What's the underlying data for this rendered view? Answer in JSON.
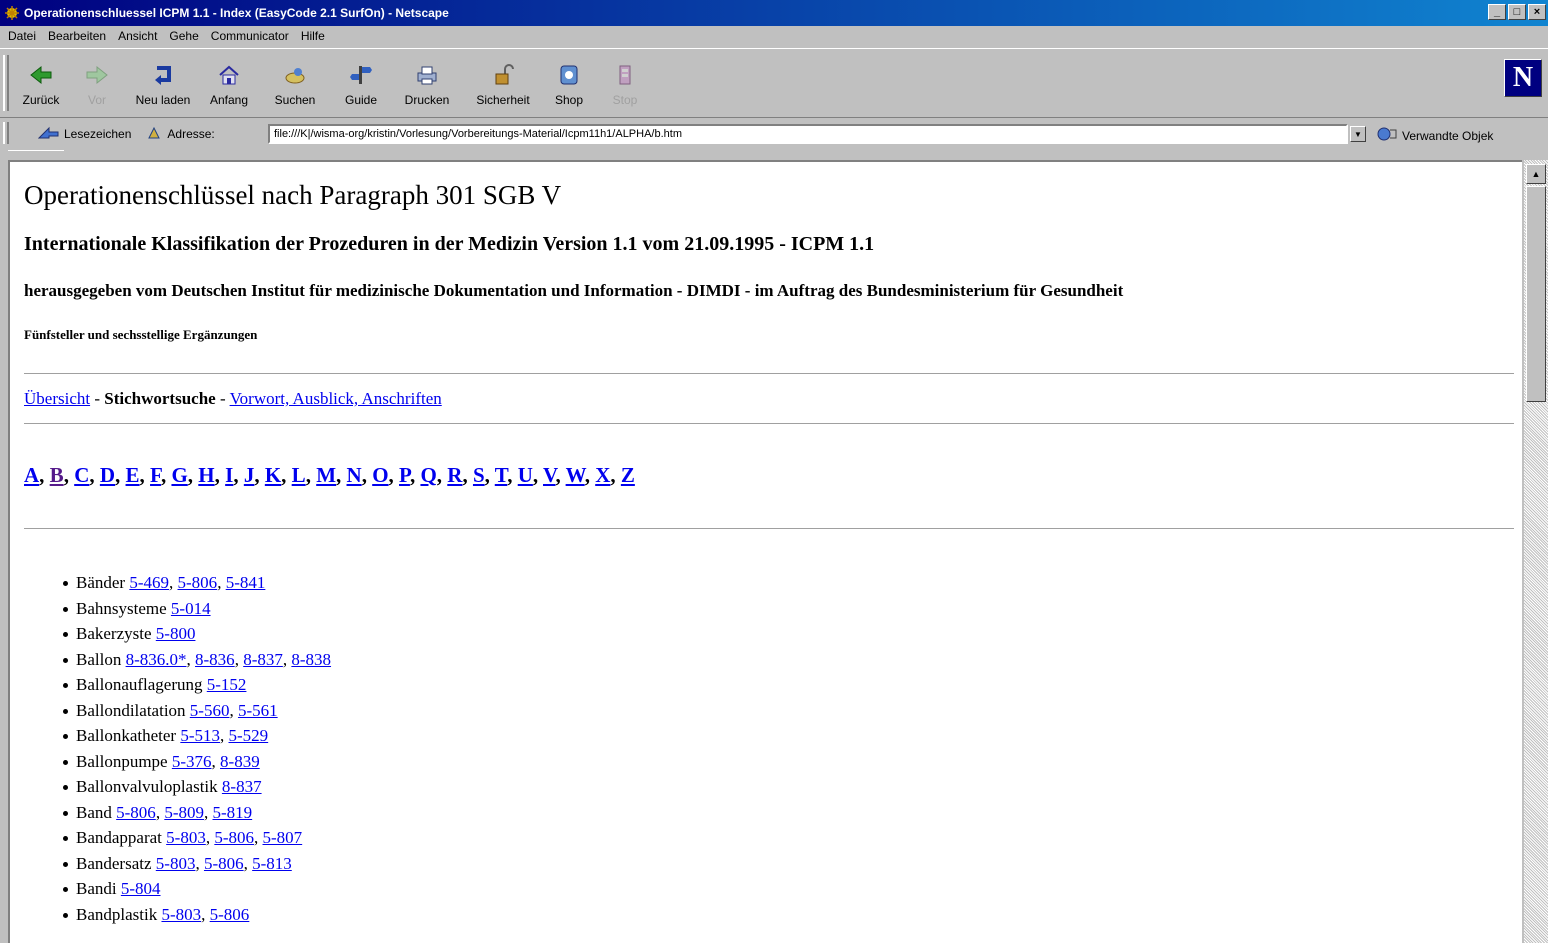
{
  "window": {
    "title": "Operationenschluessel ICPM 1.1 - Index (EasyCode 2.1 SurfOn) - Netscape",
    "controls": {
      "minimize": "_",
      "maximize": "□",
      "close": "×"
    }
  },
  "menu": [
    "Datei",
    "Bearbeiten",
    "Ansicht",
    "Gehe",
    "Communicator",
    "Hilfe"
  ],
  "toolbar": [
    {
      "label": "Zurück",
      "icon": "back-arrow-icon",
      "enabled": true
    },
    {
      "label": "Vor",
      "icon": "forward-arrow-icon",
      "enabled": false
    },
    {
      "label": "Neu laden",
      "icon": "reload-icon",
      "enabled": true
    },
    {
      "label": "Anfang",
      "icon": "home-icon",
      "enabled": true
    },
    {
      "label": "Suchen",
      "icon": "search-icon",
      "enabled": true
    },
    {
      "label": "Guide",
      "icon": "guide-icon",
      "enabled": true
    },
    {
      "label": "Drucken",
      "icon": "print-icon",
      "enabled": true
    },
    {
      "label": "Sicherheit",
      "icon": "lock-icon",
      "enabled": true
    },
    {
      "label": "Shop",
      "icon": "shop-icon",
      "enabled": true
    },
    {
      "label": "Stop",
      "icon": "stop-icon",
      "enabled": false
    }
  ],
  "logo": "N",
  "location": {
    "bookmarks_label": "Lesezeichen",
    "address_label": "Adresse:",
    "url": "file:///K|/wisma-org/kristin/Vorlesung/Vorbereitungs-Material/Icpm11h1/ALPHA/b.htm",
    "related_label": "Verwandte Objek"
  },
  "page": {
    "h1": "Operationenschlüssel nach Paragraph 301 SGB V",
    "h3": "Internationale Klassifikation der Prozeduren in der Medizin Version 1.1 vom 21.09.1995 - ICPM 1.1",
    "h4": "herausgegeben vom Deutschen Institut für medizinische Dokumentation und Information - DIMDI - im Auftrag des Bundesministerium für Gesundheit",
    "h5": "Fünfsteller und sechsstellige Ergänzungen",
    "nav": {
      "overview": "Übersicht",
      "sep1": " - ",
      "current": "Stichwortsuche",
      "sep2": " - ",
      "preface": "Vorwort, Ausblick, Anschriften"
    },
    "letters": [
      "A",
      "B",
      "C",
      "D",
      "E",
      "F",
      "G",
      "H",
      "I",
      "J",
      "K",
      "L",
      "M",
      "N",
      "O",
      "P",
      "Q",
      "R",
      "S",
      "T",
      "U",
      "V",
      "W",
      "X",
      "Z"
    ],
    "current_letter": "B",
    "entries": [
      {
        "term": "Bänder",
        "codes": [
          "5-469",
          "5-806",
          "5-841"
        ]
      },
      {
        "term": "Bahnsysteme",
        "codes": [
          "5-014"
        ]
      },
      {
        "term": "Bakerzyste",
        "codes": [
          "5-800"
        ]
      },
      {
        "term": "Ballon",
        "codes": [
          "8-836.0*",
          "8-836",
          "8-837",
          "8-838"
        ]
      },
      {
        "term": "Ballonauflagerung",
        "codes": [
          "5-152"
        ]
      },
      {
        "term": "Ballondilatation",
        "codes": [
          "5-560",
          "5-561"
        ]
      },
      {
        "term": "Ballonkatheter",
        "codes": [
          "5-513",
          "5-529"
        ]
      },
      {
        "term": "Ballonpumpe",
        "codes": [
          "5-376",
          "8-839"
        ]
      },
      {
        "term": "Ballonvalvuloplastik",
        "codes": [
          "8-837"
        ]
      },
      {
        "term": "Band",
        "codes": [
          "5-806",
          "5-809",
          "5-819"
        ]
      },
      {
        "term": "Bandapparat",
        "codes": [
          "5-803",
          "5-806",
          "5-807"
        ]
      },
      {
        "term": "Bandersatz",
        "codes": [
          "5-803",
          "5-806",
          "5-813"
        ]
      },
      {
        "term": "Bandi",
        "codes": [
          "5-804"
        ]
      },
      {
        "term": "Bandplastik",
        "codes": [
          "5-803",
          "5-806"
        ]
      }
    ]
  }
}
